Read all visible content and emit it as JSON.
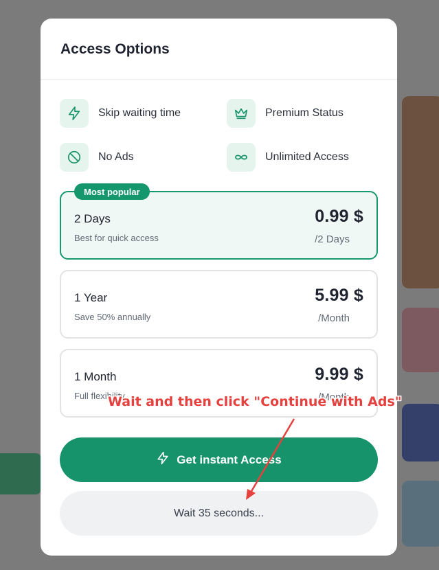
{
  "modal": {
    "title": "Access Options",
    "features": [
      {
        "label": "Skip waiting time",
        "icon": "lightning-icon"
      },
      {
        "label": "Premium Status",
        "icon": "crown-icon"
      },
      {
        "label": "No Ads",
        "icon": "no-ads-icon"
      },
      {
        "label": "Unlimited Access",
        "icon": "infinity-icon"
      }
    ],
    "plans": [
      {
        "badge": "Most popular",
        "name": "2 Days",
        "description": "Best for quick access",
        "price": "0.99 $",
        "period": "/2 Days",
        "selected": true
      },
      {
        "name": "1 Year",
        "description": "Save 50% annually",
        "price": "5.99 $",
        "period": "/Month",
        "selected": false
      },
      {
        "name": "1 Month",
        "description": "Full flexibility",
        "price": "9.99 $",
        "period": "/Month",
        "selected": false
      }
    ],
    "cta_label": "Get instant Access",
    "wait_label": "Wait 35 seconds..."
  },
  "annotation": {
    "text": "Wait and then click \"Continue with Ads\""
  },
  "colors": {
    "accent": "#17936b",
    "accent_light": "#e6f4ee",
    "annotation": "#e5413e"
  }
}
